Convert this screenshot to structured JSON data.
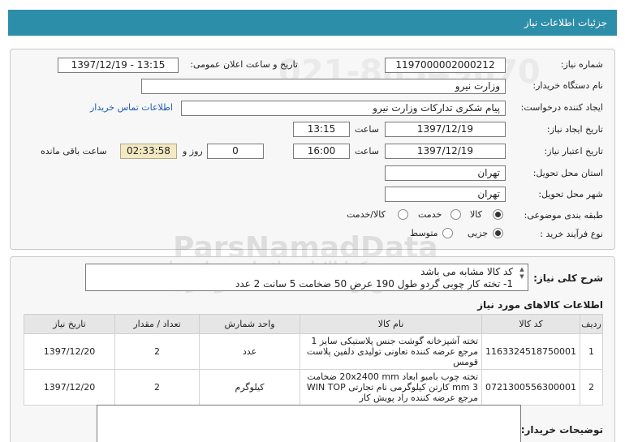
{
  "header": {
    "title": "جزئیات اطلاعات نیاز"
  },
  "form": {
    "need_number": {
      "label": "شماره نیاز:",
      "value": "1197000002000212"
    },
    "announce": {
      "label": "تاریخ و ساعت اعلان عمومی:",
      "value": "1397/12/19 - 13:15"
    },
    "buyer": {
      "label": "نام دستگاه خریدار:",
      "value": "وزارت نیرو"
    },
    "requester": {
      "label": "ایجاد کننده درخواست:",
      "value": "پیام شکری تدارکات وزارت نیرو",
      "contact_link": "اطلاعات تماس خریدار"
    },
    "create_date": {
      "label": "تاریخ ایجاد نیاز:",
      "date": "1397/12/19",
      "time_label": "ساعت",
      "time": "13:15"
    },
    "validity": {
      "label": "تاریخ اعتبار نیاز:",
      "date": "1397/12/19",
      "time_label": "ساعت",
      "time": "16:00",
      "days": "0",
      "days_label": "روز و",
      "remaining": "02:33:58",
      "remaining_label": "ساعت باقی مانده"
    },
    "province": {
      "label": "استان محل تحویل:",
      "value": "تهران"
    },
    "city": {
      "label": "شهر محل تحویل:",
      "value": "تهران"
    },
    "category": {
      "label": "طبقه بندی موضوعی:",
      "options": [
        "کالا",
        "خدمت",
        "کالا/خدمت"
      ],
      "selected": "کالا"
    },
    "process": {
      "label": "نوع فرآیند خرید :",
      "options": [
        "جزیی",
        "متوسط"
      ],
      "selected": "جزیی"
    }
  },
  "summary": {
    "label": "شرح کلی نیاز:",
    "line1": "کد کالا مشابه می باشد",
    "line2": "1- تخته کار چوبی گردو طول 190 عرض 50 ضخامت 5 سانت 2 عدد"
  },
  "goods": {
    "title": "اطلاعات کالاهای مورد نیاز",
    "headers": [
      "ردیف",
      "کد کالا",
      "نام کالا",
      "واحد شمارش",
      "تعداد / مقدار",
      "تاریخ نیاز"
    ],
    "rows": [
      {
        "row": "1",
        "code": "1163324518750001",
        "name": "تخته آشپزخانه گوشت جنس پلاستیکی سایز 1 مرجع عرضه کننده تعاونی تولیدی دلفین پلاست قومس",
        "unit": "عدد",
        "qty": "2",
        "date": "1397/12/20"
      },
      {
        "row": "2",
        "code": "0721300556300001",
        "name": "تخته چوب بامبو ابعاد 20x2400 mm ضخامت 3 mm کارتن کیلوگرمی نام تجارتی WIN TOP مرجع عرضه کننده راد پویش کار",
        "unit": "کیلوگرم",
        "qty": "2",
        "date": "1397/12/20"
      }
    ]
  },
  "buyer_notes": {
    "label": "توضیحات خریدار:"
  },
  "watermark": {
    "brand": "ParsNamadData",
    "line1": "پایگاه اطلاع رسانی مناقصه و مزایده",
    "phone": "021-88349670",
    "line3": "مرکز اطلاعات مناقصات و مزایده ها"
  },
  "colors": {
    "header": "#2d8ea9",
    "link": "#1a5db5",
    "remaining_bg": "#f3eac4"
  }
}
